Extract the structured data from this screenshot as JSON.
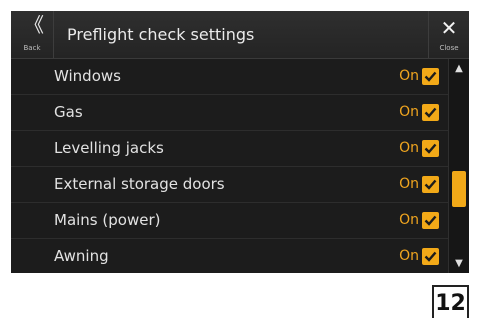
{
  "header": {
    "back_label": "Back",
    "title": "Preflight check settings",
    "close_label": "Close"
  },
  "rows": [
    {
      "label": "Windows",
      "state": "On",
      "checked": true
    },
    {
      "label": "Gas",
      "state": "On",
      "checked": true
    },
    {
      "label": "Levelling jacks",
      "state": "On",
      "checked": true
    },
    {
      "label": "External storage doors",
      "state": "On",
      "checked": true
    },
    {
      "label": "Mains (power)",
      "state": "On",
      "checked": true
    },
    {
      "label": "Awning",
      "state": "On",
      "checked": true
    }
  ],
  "scrollbar": {
    "up_icon": "triangle-up-icon",
    "down_icon": "triangle-down-icon"
  },
  "page_number": "12",
  "colors": {
    "accent": "#f2a918",
    "check_fill": "#f2a918",
    "background": "#1c1c1c"
  }
}
